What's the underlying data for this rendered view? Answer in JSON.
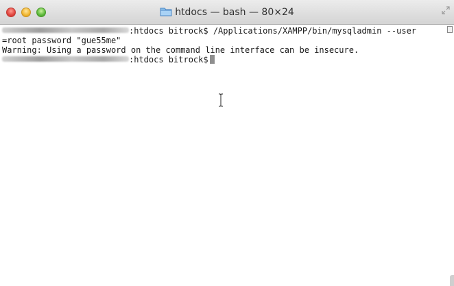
{
  "window": {
    "title": "htdocs — bash — 80×24"
  },
  "terminal": {
    "line1": ":htdocs bitrock$ /Applications/XAMPP/bin/mysqladmin --user",
    "line2": "=root password \"gue55me\"",
    "line3": "Warning: Using a password on the command line interface can be insecure.",
    "line4": ":htdocs bitrock$"
  },
  "icons": {
    "title_icon": "folder-icon",
    "mouse": "ibeam-cursor-icon"
  }
}
